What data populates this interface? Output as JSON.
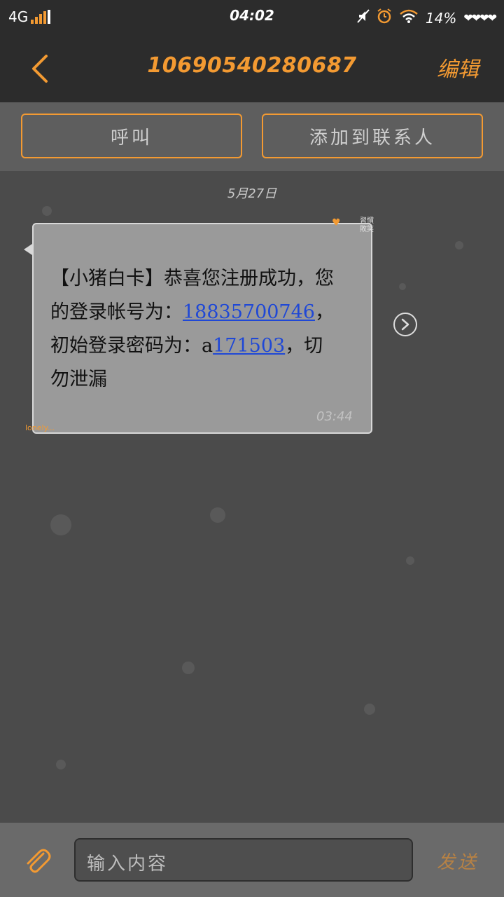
{
  "status_bar": {
    "network": "4G",
    "time": "04:02",
    "battery": "14%",
    "hearts": "❤❤❤❤"
  },
  "header": {
    "title": "10690540280687",
    "edit_label": "编辑"
  },
  "actions": {
    "call_label": "呼叫",
    "add_contact_label": "添加到联系人"
  },
  "chat": {
    "date": "5月27日",
    "message": {
      "part1": "【小猪白卡】恭喜您注册成功，您的登录帐号为：",
      "account": "18835700746",
      "part2": "，初始登录密码为：a",
      "password": "171503",
      "part3": "，切勿泄漏",
      "time": "03:44"
    },
    "bubble_deco": "習慣 敗笑",
    "lonely": "lonely..."
  },
  "composer": {
    "placeholder": "输入内容",
    "send_label": "发送"
  },
  "colors": {
    "accent": "#f39a32",
    "link": "#1f48d6",
    "bubble": "#9a9a9a"
  },
  "icons": [
    "back-icon",
    "attach-icon",
    "forward-icon",
    "alarm-icon",
    "wifi-icon",
    "mute-icon"
  ]
}
